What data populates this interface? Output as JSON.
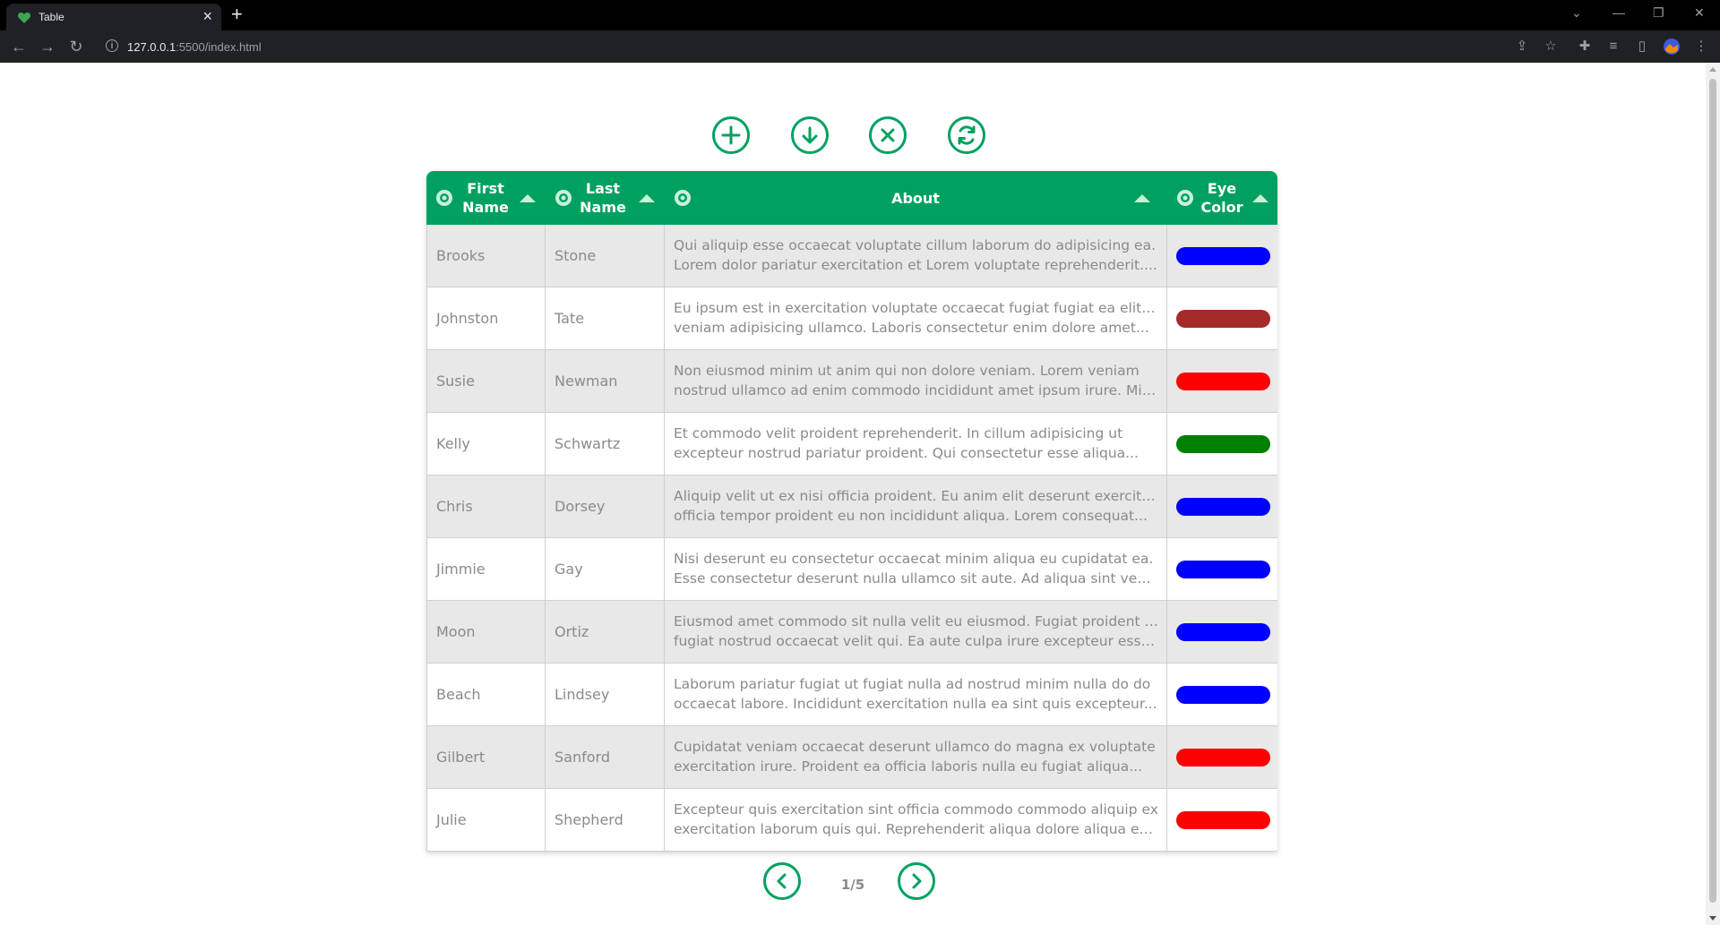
{
  "browser": {
    "tab_title": "Table",
    "url_host": "127.0.0.1",
    "url_rest": ":5500/index.html"
  },
  "actions": [
    {
      "name": "add",
      "icon": "plus-icon"
    },
    {
      "name": "download",
      "icon": "arrow-down-icon"
    },
    {
      "name": "clear",
      "icon": "x-icon"
    },
    {
      "name": "refresh",
      "icon": "refresh-icon"
    }
  ],
  "table": {
    "columns": [
      {
        "line1": "First",
        "line2": "Name"
      },
      {
        "line1": "Last",
        "line2": "Name"
      },
      {
        "line1": "About",
        "line2": ""
      },
      {
        "line1": "Eye",
        "line2": "Color"
      }
    ],
    "rows": [
      {
        "first": "Brooks",
        "last": "Stone",
        "about1": "Qui aliquip esse occaecat voluptate cillum laborum do adipisicing ea.",
        "about2": "Lorem dolor pariatur exercitation et Lorem voluptate reprehenderit....",
        "eye": "#0000ff"
      },
      {
        "first": "Johnston",
        "last": "Tate",
        "about1": "Eu ipsum est in exercitation voluptate occaecat fugiat fugiat ea elit ad",
        "about2": "veniam adipisicing ullamco. Laboris consectetur enim dolore amet...",
        "eye": "#a52a2a"
      },
      {
        "first": "Susie",
        "last": "Newman",
        "about1": "Non eiusmod minim ut anim qui non dolore veniam. Lorem veniam",
        "about2": "nostrud ullamco ad enim commodo incididunt amet ipsum irure. Mini...",
        "eye": "#ff0000"
      },
      {
        "first": "Kelly",
        "last": "Schwartz",
        "about1": "Et commodo velit proident reprehenderit. In cillum adipisicing ut",
        "about2": "excepteur nostrud pariatur proident. Qui consectetur esse aliqua...",
        "eye": "#008000"
      },
      {
        "first": "Chris",
        "last": "Dorsey",
        "about1": "Aliquip velit ut ex nisi officia proident. Eu anim elit deserunt exercitation",
        "about2": "officia tempor proident eu non incididunt aliqua. Lorem consequat...",
        "eye": "#0000ff"
      },
      {
        "first": "Jimmie",
        "last": "Gay",
        "about1": "Nisi deserunt eu consectetur occaecat minim aliqua eu cupidatat ea.",
        "about2": "Esse consectetur deserunt nulla ullamco sit aute. Ad aliqua sint veniam...",
        "eye": "#0000ff"
      },
      {
        "first": "Moon",
        "last": "Ortiz",
        "about1": "Eiusmod amet commodo sit nulla velit eu eiusmod. Fugiat proident sunt",
        "about2": "fugiat nostrud occaecat velit qui. Ea aute culpa irure excepteur esse....",
        "eye": "#0000ff"
      },
      {
        "first": "Beach",
        "last": "Lindsey",
        "about1": "Laborum pariatur fugiat ut fugiat nulla ad nostrud minim nulla do do",
        "about2": "occaecat labore. Incididunt exercitation nulla ea sint quis excepteur...",
        "eye": "#0000ff"
      },
      {
        "first": "Gilbert",
        "last": "Sanford",
        "about1": "Cupidatat veniam occaecat deserunt ullamco do magna ex voluptate",
        "about2": "exercitation irure. Proident ea officia laboris nulla eu fugiat aliqua...",
        "eye": "#ff0000"
      },
      {
        "first": "Julie",
        "last": "Shepherd",
        "about1": "Excepteur quis exercitation sint officia commodo commodo aliquip ex",
        "about2": "exercitation laborum quis qui. Reprehenderit aliqua dolore aliqua est...",
        "eye": "#ff0000"
      }
    ]
  },
  "pager": {
    "text": "1/5"
  },
  "colors": {
    "accent": "#00a160",
    "row_alt": "#e8e8e8"
  }
}
